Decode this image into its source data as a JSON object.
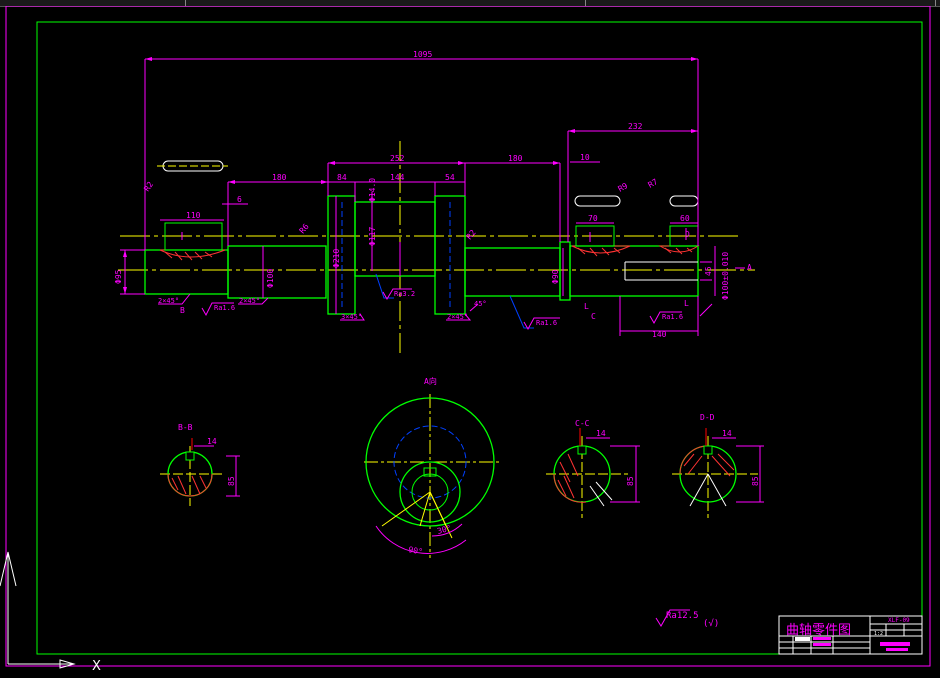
{
  "colors": {
    "background": "#000000",
    "frame": "#ff00ff",
    "inner_frame": "#00ff00",
    "centerline": "#ffff00",
    "dimension": "#ff00ff",
    "outline": "#00ff00",
    "hidden": "#0040ff",
    "hatch": "#ff3333",
    "symbol": "#ff0000",
    "white": "#ffffff"
  },
  "dims": {
    "overall": "1095",
    "d232": "232",
    "d252": "252",
    "d180a": "180",
    "d180b": "180",
    "d84": "84",
    "d144": "144",
    "d54": "54",
    "d110": "110",
    "d6": "6",
    "d10": "10",
    "d70": "70",
    "d60": "60",
    "d140": "140",
    "dia95": "Φ95",
    "dia100": "Φ100",
    "dia210": "Φ210",
    "dia117": "Φ117",
    "dia90": "Φ90",
    "dia100tol": "Φ100±0.010",
    "d45": "45",
    "r2": "R2",
    "r9": "R9",
    "r7": "R7",
    "r6": "R6",
    "dia14": "Φ14.0"
  },
  "chamfers": {
    "c1": "2×45°",
    "c2": "2×45°",
    "c3": "3×45°",
    "c4": "2×45°",
    "c5": "45°"
  },
  "roughness": {
    "r1": "Ra1.6",
    "r2": "Ra3.2",
    "r3": "Ra1.6",
    "r4": "Ra1.6"
  },
  "labels": {
    "A": "A",
    "B": "B",
    "C": "C",
    "D": "D",
    "L": "L",
    "L2": "L"
  },
  "sections": {
    "bb": "B-B",
    "av": "A向",
    "cc": "C-C",
    "dd": "D-D",
    "bb_key": "14",
    "bb_h": "85",
    "cc_key": "14",
    "cc_h": "85",
    "dd_key": "14",
    "dd_h": "85",
    "angle90": "90°",
    "angle30": "30°"
  },
  "general_roughness": {
    "text": "Ra12.5",
    "paren": "(√)"
  },
  "title_block": {
    "title": "曲轴零件图",
    "code": "XLF-09",
    "ratio": "1:2"
  },
  "ucs": {
    "x_label": "X"
  }
}
